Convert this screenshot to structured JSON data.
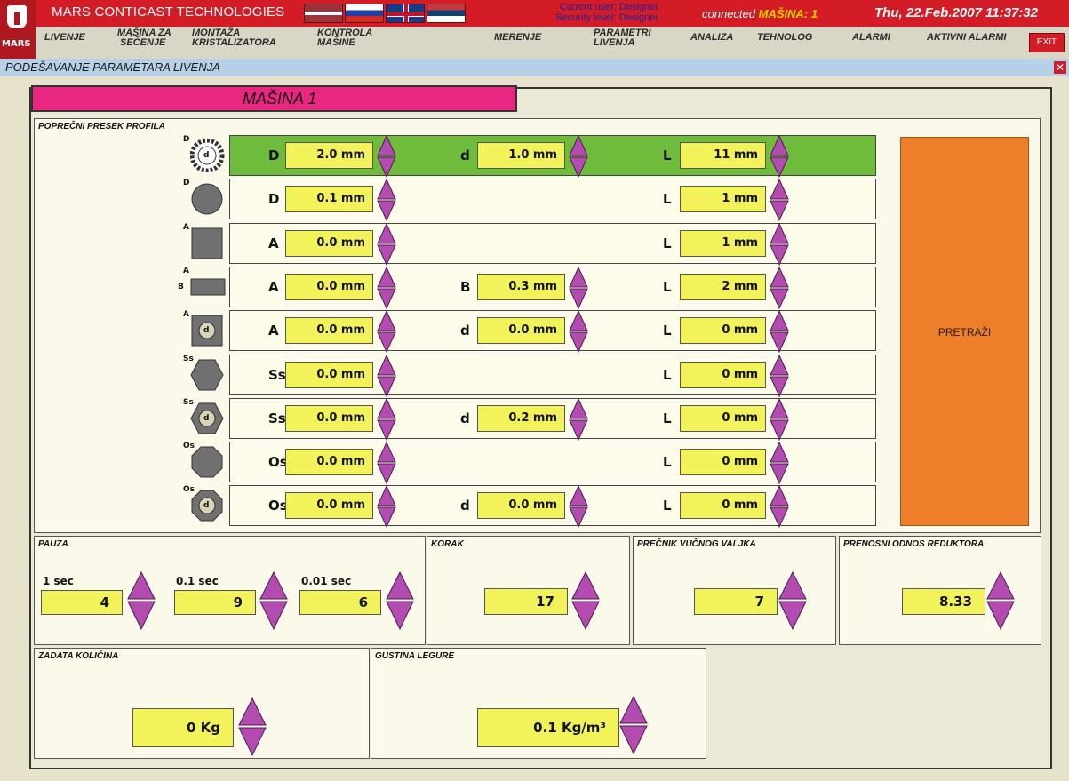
{
  "header": {
    "brand": "MARS",
    "app_title": "MARS CONTICAST TECHNOLOGIES",
    "user_line1": "Current user: Designer",
    "user_line2": "Security level: Designer",
    "connection": "connected",
    "machine": "MAŠINA: 1",
    "datetime": "Thu, 22.Feb.2007 11:37:32",
    "exit": "EXIT"
  },
  "menu": {
    "livenje": "LIVENJE",
    "masina_line1": "MAŠINA ZA",
    "masina_line2": "SEČENJE",
    "montaza_line1": "MONTAŽA",
    "montaza_line2": "KRISTALIZATORA",
    "kontrola_line1": "KONTROLA",
    "kontrola_line2": "MAŠINE",
    "merenje": "MERENJE",
    "parametri_line1": "PARAMETRI",
    "parametri_line2": "LIVENJA",
    "analiza": "ANALIZA",
    "tehnolog": "TEHNOLOG",
    "alarmi": "ALARMI",
    "aktivni": "AKTIVNI ALARMI"
  },
  "page": {
    "title": "PODEŠAVANJE PARAMETARA LIVENJA",
    "close": "✕",
    "machine_banner": "MAŠINA  1"
  },
  "profile": {
    "panel_title": "POPREČNI PRESEK PROFILA",
    "search": "PRETRAŽI",
    "rows": [
      {
        "shape": "round-hollow",
        "tags": [
          "D",
          "d"
        ],
        "f1": "D",
        "v1": "2.0 mm",
        "f2": "d",
        "v2": "1.0 mm",
        "f3": "L",
        "v3": "11 mm",
        "active": true
      },
      {
        "shape": "round",
        "tags": [
          "D"
        ],
        "f1": "D",
        "v1": "0.1 mm",
        "f3": "L",
        "v3": "1 mm"
      },
      {
        "shape": "square",
        "tags": [
          "A"
        ],
        "f1": "A",
        "v1": "0.0 mm",
        "f3": "L",
        "v3": "1 mm"
      },
      {
        "shape": "rect",
        "tags": [
          "A",
          "B"
        ],
        "f1": "A",
        "v1": "0.0 mm",
        "f2": "B",
        "v2": "0.3 mm",
        "f3": "L",
        "v3": "2 mm"
      },
      {
        "shape": "square-hollow",
        "tags": [
          "A",
          "d"
        ],
        "f1": "A",
        "v1": "0.0 mm",
        "f2": "d",
        "v2": "0.0 mm",
        "f3": "L",
        "v3": "0 mm"
      },
      {
        "shape": "hexagon",
        "tags": [
          "Ss"
        ],
        "f1": "Ss",
        "v1": "0.0 mm",
        "f3": "L",
        "v3": "0 mm"
      },
      {
        "shape": "hexagon-hollow",
        "tags": [
          "Ss",
          "d"
        ],
        "f1": "Ss",
        "v1": "0.0 mm",
        "f2": "d",
        "v2": "0.2 mm",
        "f3": "L",
        "v3": "0 mm"
      },
      {
        "shape": "octagon",
        "tags": [
          "Os"
        ],
        "f1": "Os",
        "v1": "0.0 mm",
        "f3": "L",
        "v3": "0 mm"
      },
      {
        "shape": "octagon-hollow",
        "tags": [
          "Os",
          "d"
        ],
        "f1": "Os",
        "v1": "0.0 mm",
        "f2": "d",
        "v2": "0.0 mm",
        "f3": "L",
        "v3": "0 mm"
      }
    ]
  },
  "pauza": {
    "title": "PAUZA",
    "l1": "1 sec",
    "v1": "4",
    "l2": "0.1 sec",
    "v2": "9",
    "l3": "0.01 sec",
    "v3": "6"
  },
  "korak": {
    "title": "KORAK",
    "value": "17"
  },
  "precnik": {
    "title": "PREČNIK VUČNOG VALJKA",
    "value": "7"
  },
  "prenosni": {
    "title": "PRENOSNI ODNOS REDUKTORA",
    "value": "8.33"
  },
  "kolicina": {
    "title": "ZADATA KOLIČINA",
    "value": "0 Kg"
  },
  "gustina": {
    "title": "GUSTINA LEGURE",
    "value": "0.1 Kg/m³"
  },
  "colors": {
    "header_red": "#d31c26",
    "banner_pink": "#e92780",
    "active_green": "#6fbb3c",
    "value_yellow": "#f2f25a",
    "spinner_purple": "#b34bb0",
    "search_orange": "#ee7f2a"
  }
}
